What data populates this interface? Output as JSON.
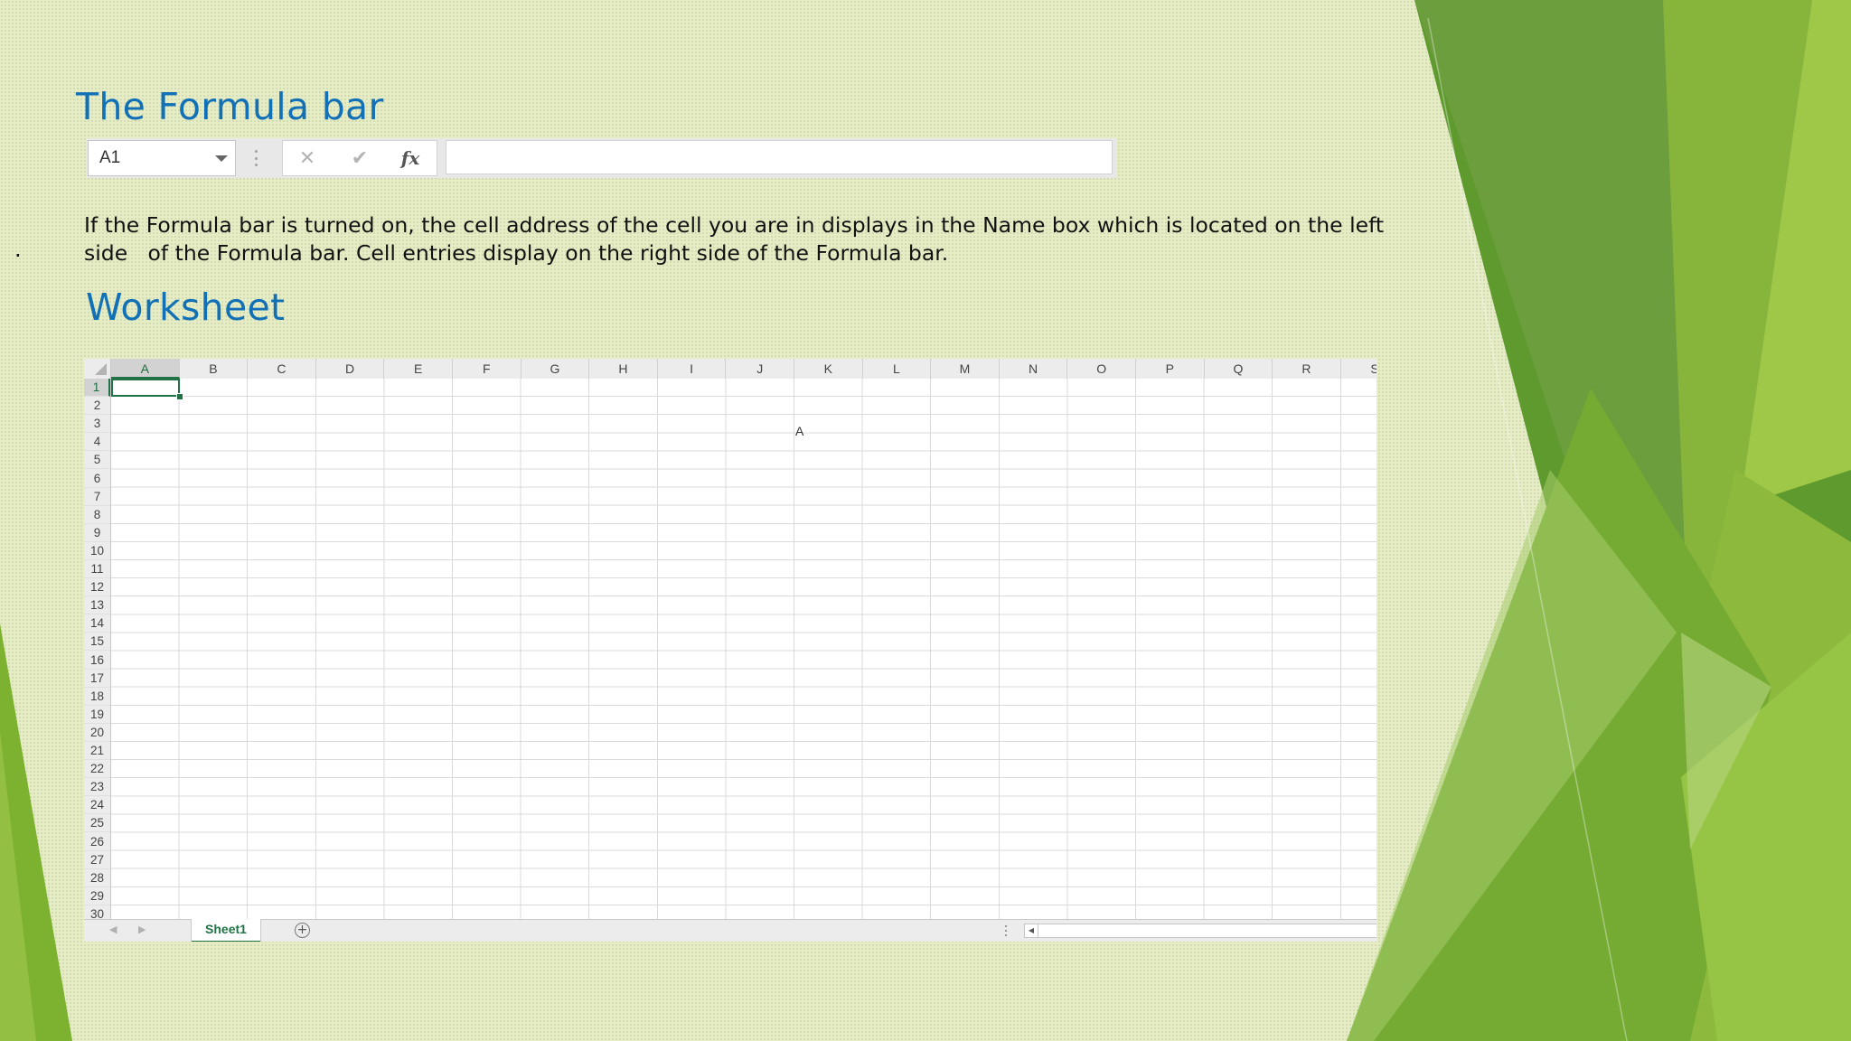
{
  "slide": {
    "title": "The Formula bar",
    "worksheet_title": "Worksheet",
    "paragraph_line1": "If the Formula bar is turned on, the cell address of the cell you are in displays in the Name box which is located on the left",
    "paragraph_line2": "side   of the Formula bar. Cell entries display on the right side of the Formula bar.",
    "bullet_mark": "."
  },
  "formula_bar": {
    "name_box_value": "A1",
    "cancel_glyph": "✕",
    "enter_glyph": "✔",
    "function_glyph": "fx",
    "formula_value": ""
  },
  "worksheet": {
    "columns": [
      "A",
      "B",
      "C",
      "D",
      "E",
      "F",
      "G",
      "H",
      "I",
      "J",
      "K",
      "L",
      "M",
      "N",
      "O",
      "P",
      "Q",
      "R",
      "S"
    ],
    "rows": [
      "1",
      "2",
      "3",
      "4",
      "5",
      "6",
      "7",
      "8",
      "9",
      "10",
      "11",
      "12",
      "13",
      "14",
      "15",
      "16",
      "17",
      "18",
      "19",
      "20",
      "21",
      "22",
      "23",
      "24",
      "25",
      "26",
      "27",
      "28",
      "29",
      "30"
    ],
    "active_cell": "A1",
    "cell_K4": "A",
    "sheet_tab": "Sheet1",
    "add_sheet_glyph": "+",
    "nav_prev_glyph": "◀",
    "nav_next_glyph": "▶",
    "scroll_left_glyph": "◀"
  },
  "colors": {
    "title_blue": "#1170b6",
    "excel_green": "#217346",
    "background": "#e5ecc6"
  }
}
